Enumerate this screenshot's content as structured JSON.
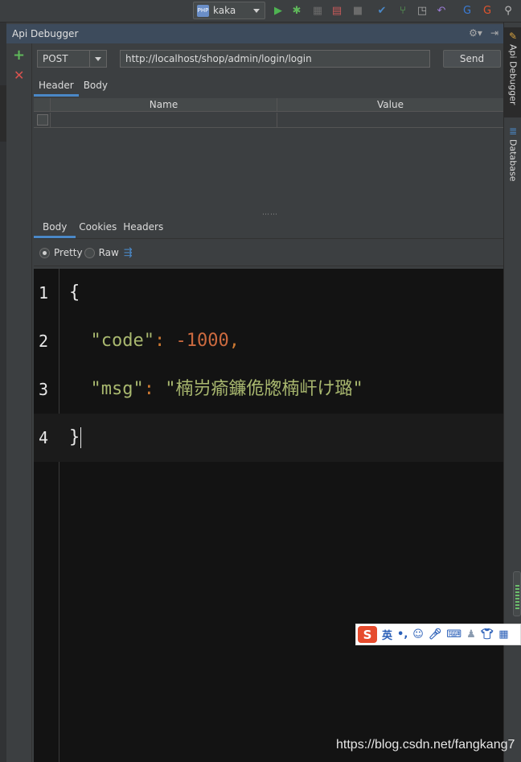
{
  "toolbar": {
    "run_config": "kaka",
    "run_config_badge": "PHP"
  },
  "tool_window": {
    "title": "Api Debugger"
  },
  "request": {
    "method": "POST",
    "url": "http://localhost/shop/admin/login/login",
    "send_label": "Send",
    "tabs": [
      "Header",
      "Body"
    ],
    "header_table": {
      "columns": [
        "Name",
        "Value"
      ]
    }
  },
  "response": {
    "tabs": [
      "Body",
      "Cookies",
      "Headers"
    ],
    "formats": [
      "Pretty",
      "Raw"
    ],
    "selected_format": "Pretty",
    "lines": [
      {
        "number": "1",
        "text": "{"
      },
      {
        "number": "2",
        "key": "\"code\"",
        "colon": ": ",
        "value": "-1000",
        "tail": ","
      },
      {
        "number": "3",
        "key": "\"msg\"",
        "colon": ": ",
        "value": "\"楠岃瘉鐮佹牎楠屽け璐\""
      },
      {
        "number": "4",
        "text": "}"
      }
    ]
  },
  "side_tabs": {
    "api_debugger": "Api Debugger",
    "database": "Database"
  },
  "ime": {
    "logo": "S",
    "mode": "英",
    "punct": "•,"
  },
  "watermark": "https://blog.csdn.net/fangkang7",
  "colors": {
    "accent_tab": "#4a88c7",
    "add_green": "#5fb85a",
    "delete_red": "#d9534f",
    "json_key": "#a9b86f",
    "json_number": "#cc6a3f",
    "editor_bg": "#131313"
  }
}
